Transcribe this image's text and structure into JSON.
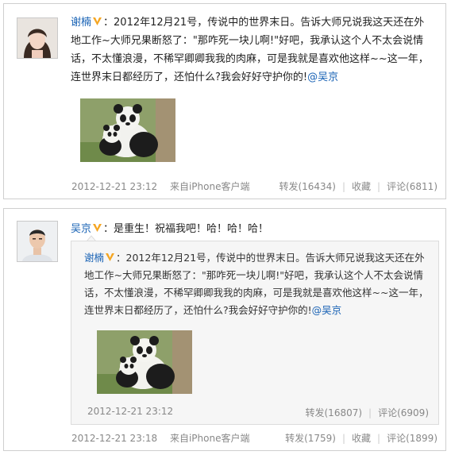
{
  "posts": [
    {
      "author": "谢楠",
      "colon": "：",
      "text": "2012年12月21号，传说中的世界末日。告诉大师兄说我这天还在外地工作~大师兄果断怒了：\"那咋死一块儿啊!\"好吧，我承认这个人不太会说情话，不太懂浪漫，不稀罕卿卿我我的肉麻，可是我就是喜欢他这样~~这一年，连世界末日都经历了，还怕什么?我会好好守护你的!",
      "mention": "@吴京",
      "timestamp": "2012-12-21 23:12",
      "source": "来自iPhone客户端",
      "repost_label": "转发(16434)",
      "favorite_label": "收藏",
      "comment_label": "评论(6811)"
    },
    {
      "author": "吴京",
      "colon": "：",
      "text": "是重生！祝福我吧！哈！哈！哈！",
      "timestamp": "2012-12-21 23:18",
      "source": "来自iPhone客户端",
      "repost_label": "转发(1759)",
      "favorite_label": "收藏",
      "comment_label": "评论(1899)",
      "quoted": {
        "author": "谢楠",
        "colon": "：",
        "text": "2012年12月21号，传说中的世界末日。告诉大师兄说我这天还在外地工作~大师兄果断怒了：\"那咋死一块儿啊!\"好吧，我承认这个人不太会说情话，不太懂浪漫，不稀罕卿卿我我的肉麻，可是我就是喜欢他这样~~这一年，连世界末日都经历了，还怕什么?我会好好守护你的!",
        "mention": "@吴京",
        "timestamp": "2012-12-21 23:12",
        "repost_label": "转发(16807)",
        "comment_label": "评论(6909)"
      }
    }
  ],
  "colors": {
    "link": "#1a63b5",
    "meta": "#888888",
    "verified_badge": "#f5a623",
    "quote_bg": "#f6f6f6"
  }
}
